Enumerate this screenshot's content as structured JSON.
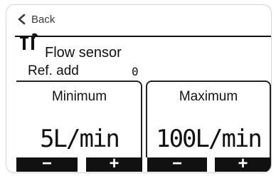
{
  "nav": {
    "back_label": "Back",
    "back_icon": "chevron-left-icon"
  },
  "header": {
    "icon": "tools-icon",
    "title": "Flow sensor"
  },
  "ref": {
    "label": "Ref. add",
    "value": "0"
  },
  "panels": [
    {
      "label": "Minimum",
      "value": "5L/min",
      "minus": "−",
      "plus": "+"
    },
    {
      "label": "Maximum",
      "value": "100L/min",
      "minus": "−",
      "plus": "+"
    }
  ],
  "colors": {
    "text": "#111111",
    "button_bg": "#111111",
    "button_text": "#ffffff"
  }
}
